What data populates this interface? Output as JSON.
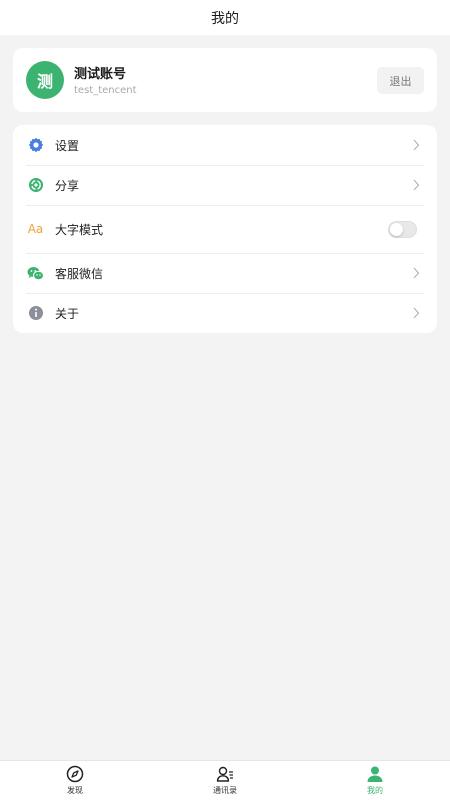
{
  "nav": {
    "title": "我的"
  },
  "profile": {
    "avatar_char": "测",
    "name": "测试账号",
    "account_id": "test_tencent",
    "logout_label": "退出"
  },
  "menu": {
    "items": [
      {
        "label": "设置",
        "icon": "gear-icon",
        "type": "link"
      },
      {
        "label": "分享",
        "icon": "share-icon",
        "type": "link"
      },
      {
        "label": "大字模式",
        "icon": "font-size-icon",
        "icon_text": "Aa",
        "type": "toggle",
        "enabled": false
      },
      {
        "label": "客服微信",
        "icon": "wechat-icon",
        "type": "link"
      },
      {
        "label": "关于",
        "icon": "info-icon",
        "type": "link"
      }
    ]
  },
  "tabs": [
    {
      "label": "发现",
      "icon": "compass-icon",
      "active": false
    },
    {
      "label": "通讯录",
      "icon": "contacts-icon",
      "active": false
    },
    {
      "label": "我的",
      "icon": "user-icon",
      "active": true
    }
  ],
  "colors": {
    "accent": "#3cb371",
    "gear": "#4a7fe0",
    "share": "#3cb371",
    "font_size": "#f0a23a",
    "wechat": "#3cb371",
    "info": "#8a8f99",
    "background": "#f3f3f3"
  }
}
